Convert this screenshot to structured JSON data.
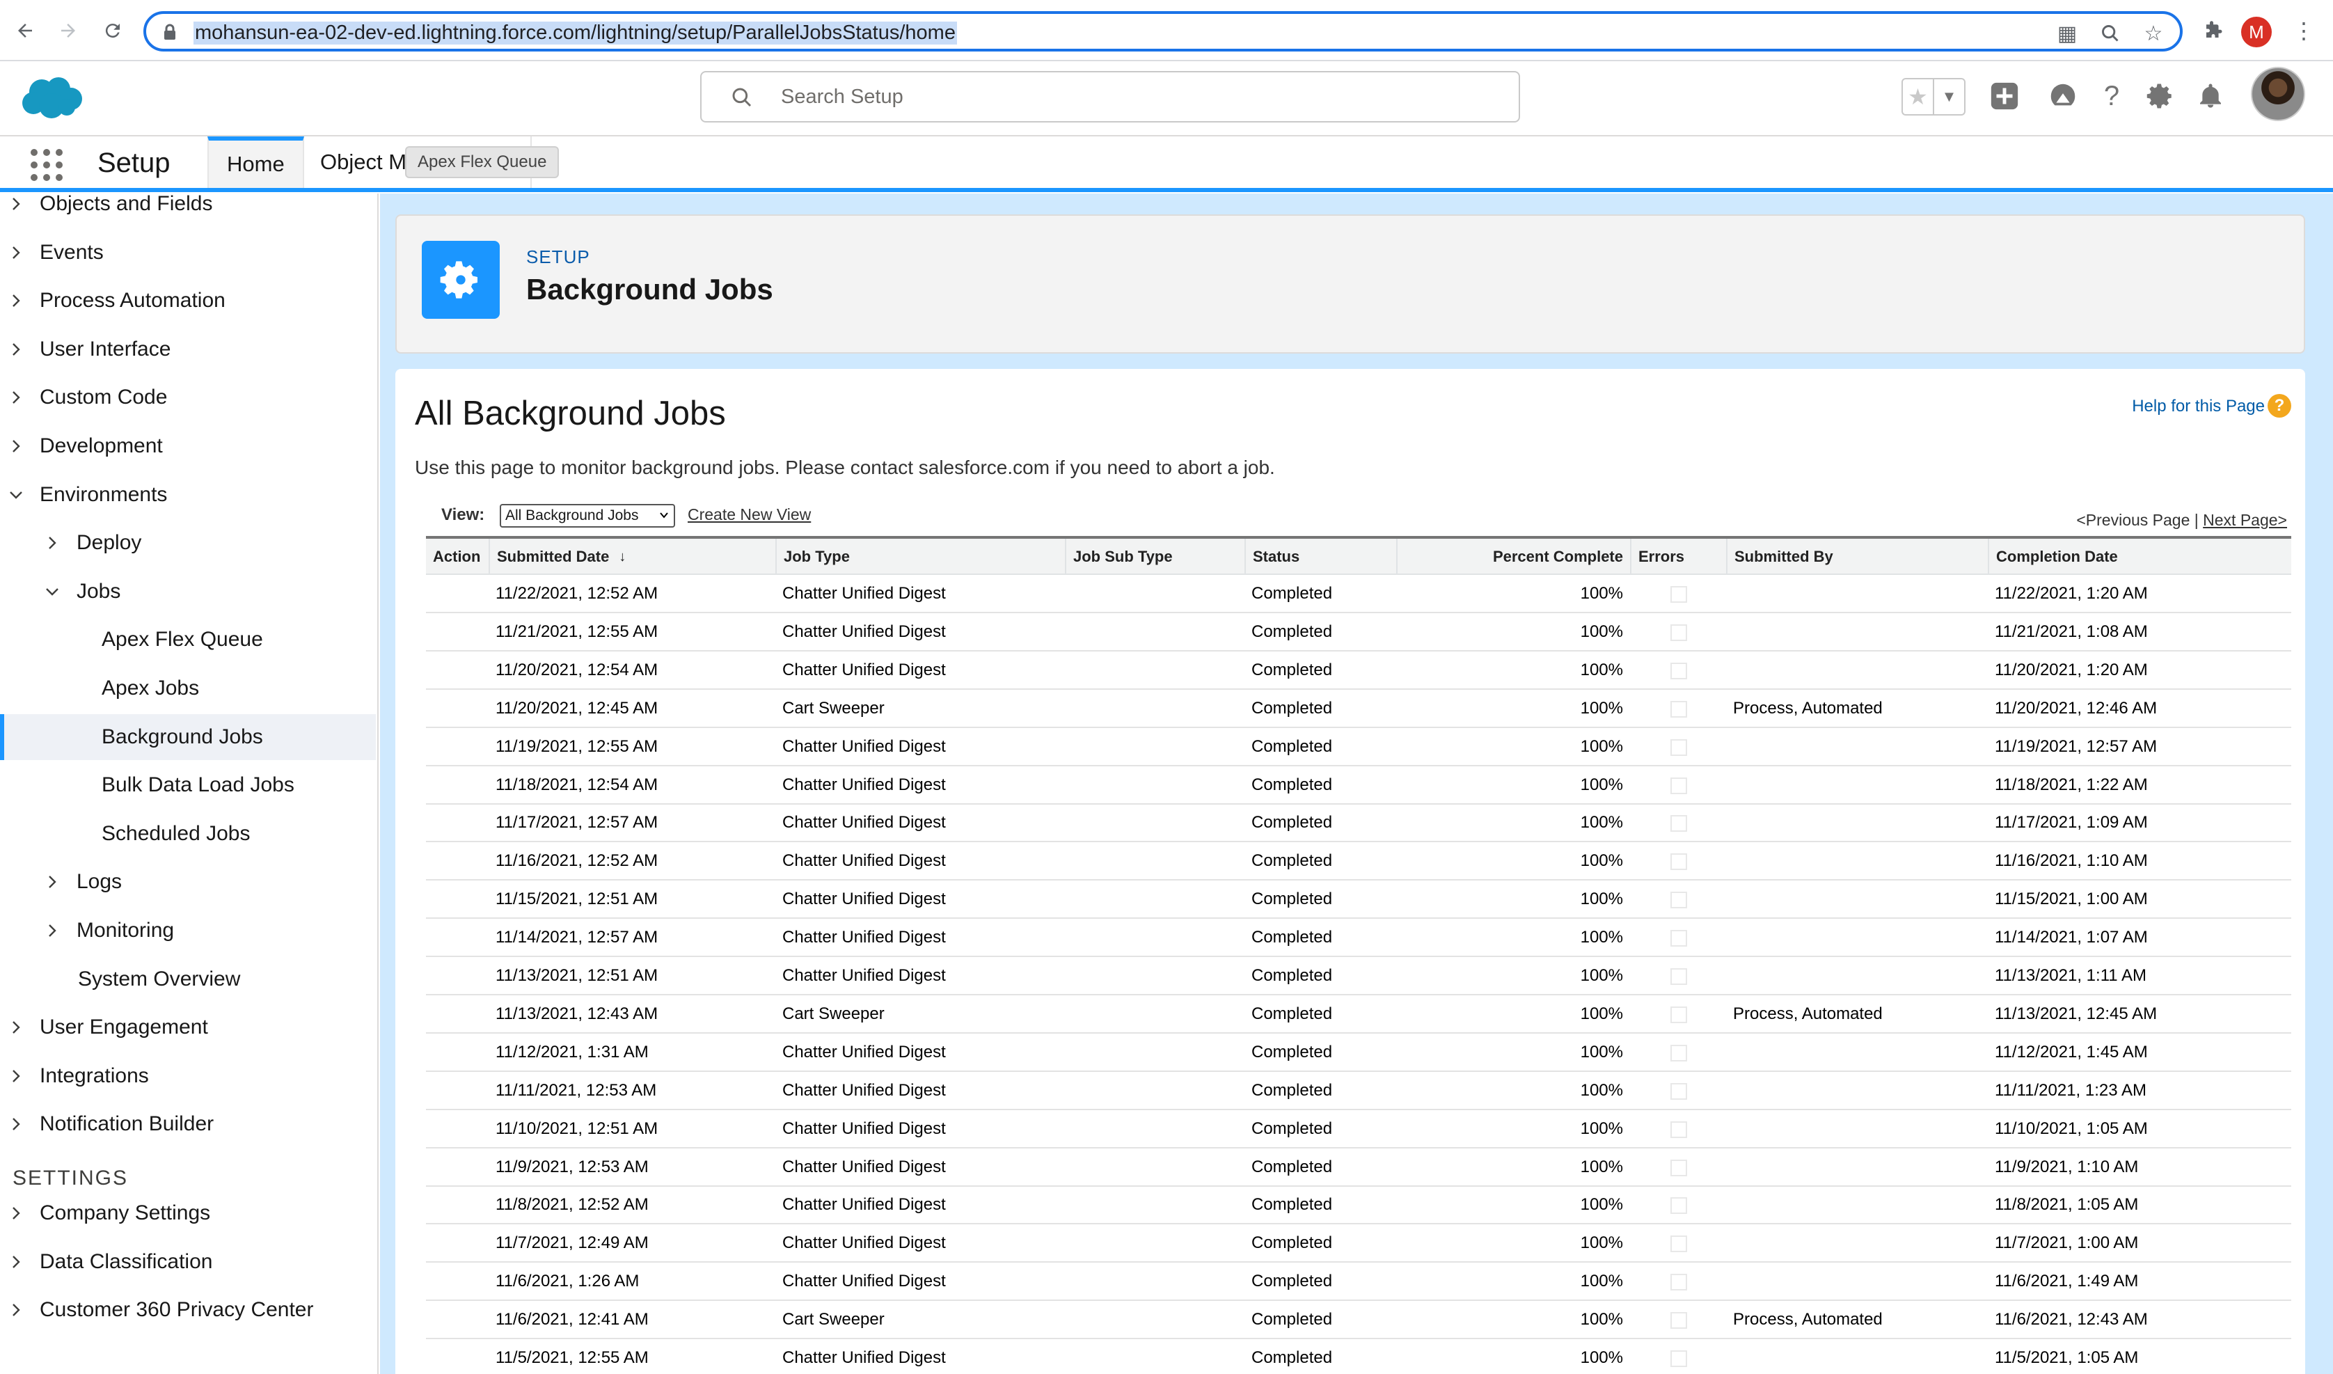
{
  "browser": {
    "url": "mohansun-ea-02-dev-ed.lightning.force.com/lightning/setup/ParallelJobsStatus/home",
    "profile_initial": "M"
  },
  "header": {
    "search_placeholder": "Search Setup"
  },
  "tabbar": {
    "app_name": "Setup",
    "tabs": [
      {
        "label": "Home"
      },
      {
        "label": "Object Ma"
      }
    ],
    "tooltip": "Apex Flex Queue"
  },
  "sidebar": {
    "items": [
      {
        "label": "Objects and Fields",
        "level": 0,
        "expanded": false
      },
      {
        "label": "Events",
        "level": 0,
        "expanded": false
      },
      {
        "label": "Process Automation",
        "level": 0,
        "expanded": false
      },
      {
        "label": "User Interface",
        "level": 0,
        "expanded": false
      },
      {
        "label": "Custom Code",
        "level": 0,
        "expanded": false
      },
      {
        "label": "Development",
        "level": 0,
        "expanded": false
      },
      {
        "label": "Environments",
        "level": 0,
        "expanded": true
      },
      {
        "label": "Deploy",
        "level": 1,
        "expanded": false
      },
      {
        "label": "Jobs",
        "level": 1,
        "expanded": true
      },
      {
        "label": "Apex Flex Queue",
        "level": 2
      },
      {
        "label": "Apex Jobs",
        "level": 2
      },
      {
        "label": "Background Jobs",
        "level": 2,
        "selected": true
      },
      {
        "label": "Bulk Data Load Jobs",
        "level": 2
      },
      {
        "label": "Scheduled Jobs",
        "level": 2
      },
      {
        "label": "Logs",
        "level": 1,
        "expanded": false
      },
      {
        "label": "Monitoring",
        "level": 1,
        "expanded": false
      },
      {
        "label": "System Overview",
        "level": 1
      },
      {
        "label": "User Engagement",
        "level": 0,
        "expanded": false
      },
      {
        "label": "Integrations",
        "level": 0,
        "expanded": false
      },
      {
        "label": "Notification Builder",
        "level": 0,
        "expanded": false
      }
    ],
    "settings_header": "SETTINGS",
    "settings_items": [
      {
        "label": "Company Settings"
      },
      {
        "label": "Data Classification"
      },
      {
        "label": "Customer 360 Privacy Center"
      }
    ]
  },
  "page_header": {
    "eyebrow": "SETUP",
    "title": "Background Jobs"
  },
  "content": {
    "heading": "All Background Jobs",
    "help_link": "Help for this Page",
    "description": "Use this page to monitor background jobs. Please contact salesforce.com if you need to abort a job.",
    "view_label": "View:",
    "view_selected": "All Background Jobs",
    "create_view": "Create New View",
    "prev_page": "<Previous Page",
    "separator": " | ",
    "next_page": "Next Page>"
  },
  "table": {
    "columns": [
      "Action",
      "Submitted Date",
      "Job Type",
      "Job Sub Type",
      "Status",
      "Percent Complete",
      "Errors",
      "Submitted By",
      "Completion Date"
    ],
    "sort_indicator": "↓",
    "rows": [
      [
        "",
        "11/22/2021, 12:52 AM",
        "Chatter Unified Digest",
        "",
        "Completed",
        "100%",
        "",
        "",
        "11/22/2021, 1:20 AM"
      ],
      [
        "",
        "11/21/2021, 12:55 AM",
        "Chatter Unified Digest",
        "",
        "Completed",
        "100%",
        "",
        "",
        "11/21/2021, 1:08 AM"
      ],
      [
        "",
        "11/20/2021, 12:54 AM",
        "Chatter Unified Digest",
        "",
        "Completed",
        "100%",
        "",
        "",
        "11/20/2021, 1:20 AM"
      ],
      [
        "",
        "11/20/2021, 12:45 AM",
        "Cart Sweeper",
        "",
        "Completed",
        "100%",
        "",
        "Process, Automated",
        "11/20/2021, 12:46 AM"
      ],
      [
        "",
        "11/19/2021, 12:55 AM",
        "Chatter Unified Digest",
        "",
        "Completed",
        "100%",
        "",
        "",
        "11/19/2021, 12:57 AM"
      ],
      [
        "",
        "11/18/2021, 12:54 AM",
        "Chatter Unified Digest",
        "",
        "Completed",
        "100%",
        "",
        "",
        "11/18/2021, 1:22 AM"
      ],
      [
        "",
        "11/17/2021, 12:57 AM",
        "Chatter Unified Digest",
        "",
        "Completed",
        "100%",
        "",
        "",
        "11/17/2021, 1:09 AM"
      ],
      [
        "",
        "11/16/2021, 12:52 AM",
        "Chatter Unified Digest",
        "",
        "Completed",
        "100%",
        "",
        "",
        "11/16/2021, 1:10 AM"
      ],
      [
        "",
        "11/15/2021, 12:51 AM",
        "Chatter Unified Digest",
        "",
        "Completed",
        "100%",
        "",
        "",
        "11/15/2021, 1:00 AM"
      ],
      [
        "",
        "11/14/2021, 12:57 AM",
        "Chatter Unified Digest",
        "",
        "Completed",
        "100%",
        "",
        "",
        "11/14/2021, 1:07 AM"
      ],
      [
        "",
        "11/13/2021, 12:51 AM",
        "Chatter Unified Digest",
        "",
        "Completed",
        "100%",
        "",
        "",
        "11/13/2021, 1:11 AM"
      ],
      [
        "",
        "11/13/2021, 12:43 AM",
        "Cart Sweeper",
        "",
        "Completed",
        "100%",
        "",
        "Process, Automated",
        "11/13/2021, 12:45 AM"
      ],
      [
        "",
        "11/12/2021, 1:31 AM",
        "Chatter Unified Digest",
        "",
        "Completed",
        "100%",
        "",
        "",
        "11/12/2021, 1:45 AM"
      ],
      [
        "",
        "11/11/2021, 12:53 AM",
        "Chatter Unified Digest",
        "",
        "Completed",
        "100%",
        "",
        "",
        "11/11/2021, 1:23 AM"
      ],
      [
        "",
        "11/10/2021, 12:51 AM",
        "Chatter Unified Digest",
        "",
        "Completed",
        "100%",
        "",
        "",
        "11/10/2021, 1:05 AM"
      ],
      [
        "",
        "11/9/2021, 12:53 AM",
        "Chatter Unified Digest",
        "",
        "Completed",
        "100%",
        "",
        "",
        "11/9/2021, 1:10 AM"
      ],
      [
        "",
        "11/8/2021, 12:52 AM",
        "Chatter Unified Digest",
        "",
        "Completed",
        "100%",
        "",
        "",
        "11/8/2021, 1:05 AM"
      ],
      [
        "",
        "11/7/2021, 12:49 AM",
        "Chatter Unified Digest",
        "",
        "Completed",
        "100%",
        "",
        "",
        "11/7/2021, 1:00 AM"
      ],
      [
        "",
        "11/6/2021, 1:26 AM",
        "Chatter Unified Digest",
        "",
        "Completed",
        "100%",
        "",
        "",
        "11/6/2021, 1:49 AM"
      ],
      [
        "",
        "11/6/2021, 12:41 AM",
        "Cart Sweeper",
        "",
        "Completed",
        "100%",
        "",
        "Process, Automated",
        "11/6/2021, 12:43 AM"
      ],
      [
        "",
        "11/5/2021, 12:55 AM",
        "Chatter Unified Digest",
        "",
        "Completed",
        "100%",
        "",
        "",
        "11/5/2021, 1:05 AM"
      ]
    ]
  },
  "colors": {
    "brand_blue": "#1b96ff",
    "link_blue": "#0b5cab",
    "main_bg": "#cfe9fe",
    "help_orange": "#f3a71d"
  }
}
